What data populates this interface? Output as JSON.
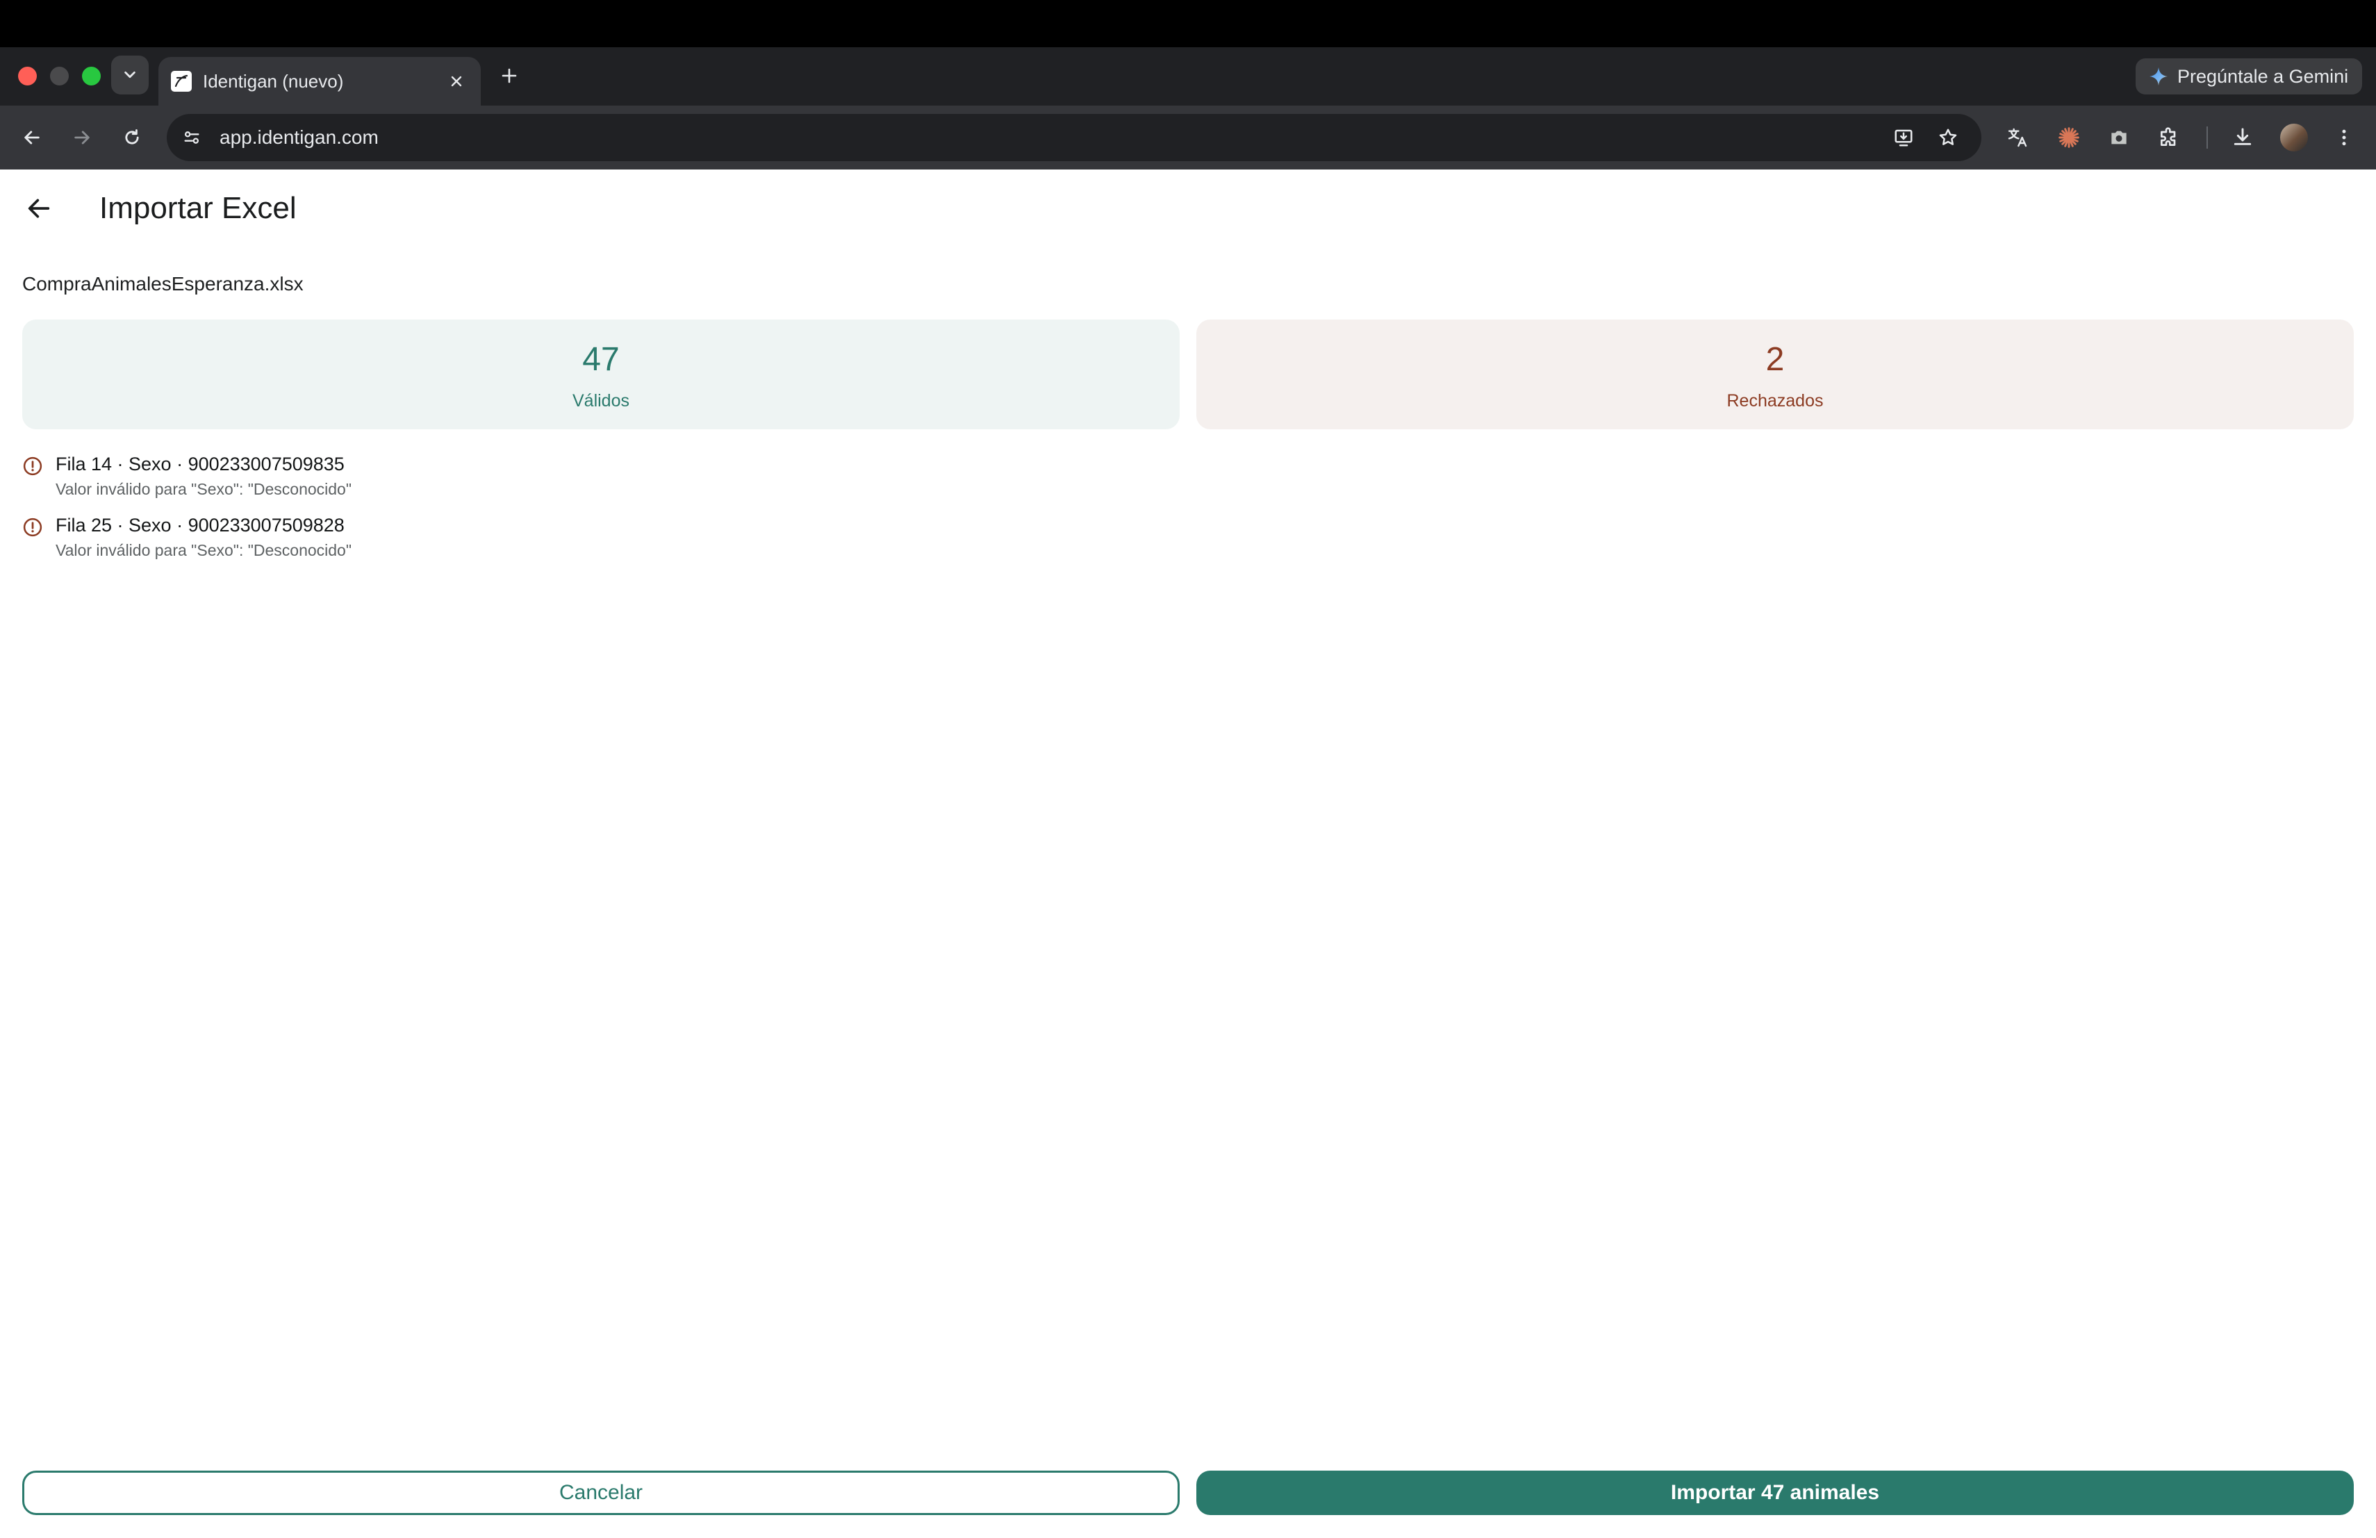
{
  "browser": {
    "tab": {
      "title": "Identigan (nuevo)"
    },
    "gemini_label": "Pregúntale a Gemini",
    "url": "app.identigan.com"
  },
  "header": {
    "title": "Importar Excel"
  },
  "import": {
    "file_name": "CompraAnimalesEsperanza.xlsx",
    "stats": {
      "valid_count": "47",
      "valid_label": "Válidos",
      "rejected_count": "2",
      "rejected_label": "Rechazados"
    },
    "errors": [
      {
        "title": "Fila 14 · Sexo · 900233007509835",
        "message": "Valor inválido para \"Sexo\": \"Desconocido\""
      },
      {
        "title": "Fila 25 · Sexo · 900233007509828",
        "message": "Valor inválido para \"Sexo\": \"Desconocido\""
      }
    ]
  },
  "actions": {
    "cancel_label": "Cancelar",
    "import_label": "Importar 47 animales"
  },
  "colors": {
    "accent": "#2a7a6c",
    "rejected": "#8c3b22",
    "valid_bg": "#eef4f3",
    "rejected_bg": "#f5f0ee"
  }
}
